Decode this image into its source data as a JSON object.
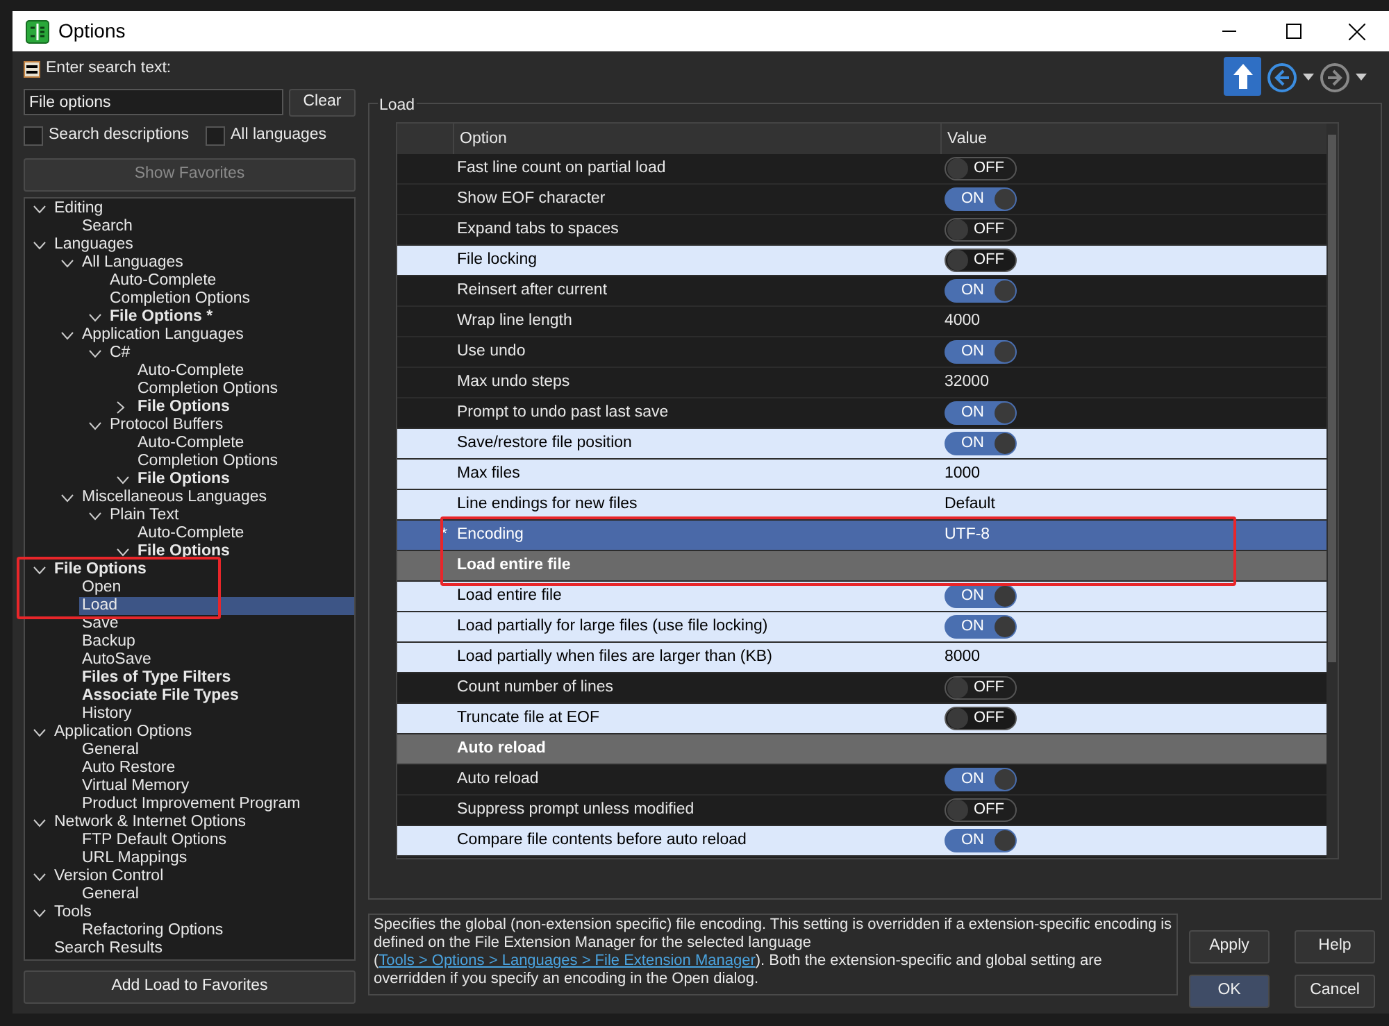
{
  "window": {
    "title": "Options"
  },
  "search": {
    "label": "Enter search text:",
    "value": "File options",
    "clear_button": "Clear"
  },
  "checkboxes": [
    {
      "label": "Search descriptions",
      "checked": false
    },
    {
      "label": "All languages",
      "checked": false
    }
  ],
  "show_favorites": {
    "label": "Show Favorites",
    "disabled": true
  },
  "tree": [
    {
      "label": "Editing",
      "expanded": true,
      "selected": false,
      "children": [
        {
          "label": "Search",
          "selected": false
        }
      ]
    },
    {
      "label": "Languages",
      "expanded": true,
      "selected": false,
      "children": [
        {
          "label": "All Languages",
          "expanded": true,
          "selected": false,
          "children": [
            {
              "label": "Auto-Complete",
              "selected": false
            },
            {
              "label": "Completion Options",
              "selected": false
            },
            {
              "label": "File Options *",
              "bold": true,
              "expanded": true,
              "selected": false
            }
          ]
        },
        {
          "label": "Application Languages",
          "expanded": true,
          "selected": false,
          "children": [
            {
              "label": "C#",
              "expanded": true,
              "selected": false,
              "children": [
                {
                  "label": "Auto-Complete",
                  "selected": false
                },
                {
                  "label": "Completion Options",
                  "selected": false
                },
                {
                  "label": "File Options",
                  "bold": true,
                  "expanded": false,
                  "selected": false
                }
              ]
            },
            {
              "label": "Protocol Buffers",
              "expanded": true,
              "selected": false,
              "children": [
                {
                  "label": "Auto-Complete",
                  "selected": false
                },
                {
                  "label": "Completion Options",
                  "selected": false
                },
                {
                  "label": "File Options",
                  "bold": true,
                  "expanded": true,
                  "selected": false
                }
              ]
            }
          ]
        },
        {
          "label": "Miscellaneous Languages",
          "expanded": true,
          "selected": false,
          "children": [
            {
              "label": "Plain Text",
              "expanded": true,
              "selected": false,
              "children": [
                {
                  "label": "Auto-Complete",
                  "selected": false
                },
                {
                  "label": "File Options",
                  "bold": true,
                  "expanded": true,
                  "selected": false
                }
              ]
            }
          ]
        }
      ]
    },
    {
      "label": "File Options",
      "bold": true,
      "expanded": true,
      "selected": false,
      "annotated": true,
      "children": [
        {
          "label": "Open",
          "selected": false,
          "annotated": true
        },
        {
          "label": "Load",
          "selected": true,
          "annotated": true
        },
        {
          "label": "Save",
          "selected": false
        },
        {
          "label": "Backup",
          "selected": false
        },
        {
          "label": "AutoSave",
          "selected": false
        },
        {
          "label": "Files of Type Filters",
          "bold": true,
          "selected": false
        },
        {
          "label": "Associate File Types",
          "bold": true,
          "selected": false
        },
        {
          "label": "History",
          "selected": false
        }
      ]
    },
    {
      "label": "Application Options",
      "expanded": true,
      "selected": false,
      "children": [
        {
          "label": "General",
          "selected": false
        },
        {
          "label": "Auto Restore",
          "selected": false
        },
        {
          "label": "Virtual Memory",
          "selected": false
        },
        {
          "label": "Product Improvement Program",
          "selected": false
        }
      ]
    },
    {
      "label": "Network & Internet Options",
      "expanded": true,
      "selected": false,
      "children": [
        {
          "label": "FTP Default Options",
          "selected": false
        },
        {
          "label": "URL Mappings",
          "selected": false
        }
      ]
    },
    {
      "label": "Version Control",
      "expanded": true,
      "selected": false,
      "children": [
        {
          "label": "General",
          "selected": false
        }
      ]
    },
    {
      "label": "Tools",
      "expanded": true,
      "selected": false,
      "children": [
        {
          "label": "Refactoring Options",
          "selected": false
        }
      ]
    },
    {
      "label": "Search Results",
      "selected": false
    }
  ],
  "add_favorites_button": "Add Load to Favorites",
  "nav_buttons": [
    {
      "kind": "up",
      "disabled": false
    },
    {
      "kind": "back",
      "disabled": false
    },
    {
      "kind": "forward",
      "disabled": true
    }
  ],
  "group": {
    "title": "Load",
    "columns": [
      "Option",
      "Value"
    ],
    "rows": [
      {
        "kind": "toggle",
        "option": "Fast line count on partial load",
        "on": false,
        "state_label": "OFF",
        "highlighted": false,
        "selected": false
      },
      {
        "kind": "toggle",
        "option": "Show EOF character",
        "on": true,
        "state_label": "ON",
        "highlighted": false,
        "selected": false
      },
      {
        "kind": "toggle",
        "option": "Expand tabs to spaces",
        "on": false,
        "state_label": "OFF",
        "highlighted": false,
        "selected": false
      },
      {
        "kind": "toggle",
        "option": "File locking",
        "on": false,
        "state_label": "OFF",
        "highlighted": true,
        "selected": false
      },
      {
        "kind": "toggle",
        "option": "Reinsert after current",
        "on": true,
        "state_label": "ON",
        "highlighted": false,
        "selected": false
      },
      {
        "kind": "value",
        "option": "Wrap line length",
        "value": "4000",
        "highlighted": false,
        "selected": false
      },
      {
        "kind": "toggle",
        "option": "Use undo",
        "on": true,
        "state_label": "ON",
        "highlighted": false,
        "selected": false
      },
      {
        "kind": "value",
        "option": "Max undo steps",
        "value": "32000",
        "highlighted": false,
        "selected": false
      },
      {
        "kind": "toggle",
        "option": "Prompt to undo past last save",
        "on": true,
        "state_label": "ON",
        "highlighted": false,
        "selected": false
      },
      {
        "kind": "toggle",
        "option": "Save/restore file position",
        "on": true,
        "state_label": "ON",
        "highlighted": true,
        "selected": false
      },
      {
        "kind": "value",
        "option": "Max files",
        "value": "1000",
        "highlighted": true,
        "selected": false
      },
      {
        "kind": "value",
        "option": "Line endings for new files",
        "value": "Default",
        "highlighted": true,
        "selected": false
      },
      {
        "kind": "value",
        "option": "Encoding",
        "value": "UTF-8",
        "marker": "*",
        "selected": true,
        "annotated": true
      },
      {
        "kind": "section",
        "option": "Load entire file",
        "annotated": true
      },
      {
        "kind": "toggle",
        "option": "Load entire file",
        "on": true,
        "state_label": "ON",
        "highlighted": true,
        "selected": false
      },
      {
        "kind": "toggle",
        "option": "Load partially for large files (use file locking)",
        "on": true,
        "state_label": "ON",
        "highlighted": true,
        "selected": false
      },
      {
        "kind": "value",
        "option": "Load partially when files are larger than (KB)",
        "value": "8000",
        "highlighted": true,
        "selected": false
      },
      {
        "kind": "toggle",
        "option": "Count number of lines",
        "on": false,
        "state_label": "OFF",
        "highlighted": false,
        "selected": false
      },
      {
        "kind": "toggle",
        "option": "Truncate file at EOF",
        "on": false,
        "state_label": "OFF",
        "highlighted": true,
        "selected": false
      },
      {
        "kind": "section",
        "option": "Auto reload"
      },
      {
        "kind": "toggle",
        "option": "Auto reload",
        "on": true,
        "state_label": "ON",
        "highlighted": false,
        "selected": false
      },
      {
        "kind": "toggle",
        "option": "Suppress prompt unless modified",
        "on": false,
        "state_label": "OFF",
        "highlighted": false,
        "selected": false
      },
      {
        "kind": "toggle",
        "option": "Compare file contents before auto reload",
        "on": true,
        "state_label": "ON",
        "highlighted": true,
        "selected": false
      }
    ]
  },
  "description": {
    "before": "Specifies the global (non-extension specific) file encoding. This setting is overridden if a extension-specific encoding is defined on the File Extension Manager for the selected language (",
    "link": "Tools > Options > Languages > File Extension Manager",
    "after": "). Both the extension-specific and global setting are overridden if you specify an encoding in the Open dialog."
  },
  "buttons": [
    {
      "label": "Apply",
      "default": false
    },
    {
      "label": "Help",
      "default": false
    },
    {
      "label": "OK",
      "default": true
    },
    {
      "label": "Cancel",
      "default": false
    }
  ]
}
